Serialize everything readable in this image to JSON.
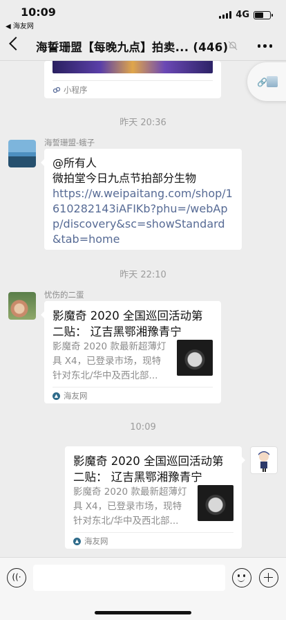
{
  "status_bar": {
    "time": "10:09",
    "back_app": "◀ 海友网",
    "network": "4G"
  },
  "nav": {
    "title": "海誓珊盟【每晚九点】拍卖... (446)"
  },
  "mini_program": {
    "label": "小程序"
  },
  "timestamps": [
    "昨天 20:36",
    "昨天 22:10",
    "10:09"
  ],
  "messages": [
    {
      "sender": "海誓珊盟-蛾子",
      "lines": [
        "@所有人",
        "微拍堂今日九点节拍部分生物"
      ],
      "link": "https://w.weipaitang.com/shop/1610282143iAFIKb?phu=/webApp/discovery&sc=showStandard&tab=home"
    },
    {
      "sender": "忧伤的二蛋",
      "card": {
        "title": "影魔奇 2020 全国巡回活动第二贴： 辽吉黑鄂湘豫青宁",
        "body": "影魔奇 2020 款最新超薄灯具 X4，已登录市场，现特针对东北/华中及西北部...",
        "source": "海友网"
      }
    },
    {
      "sender": "",
      "card": {
        "title": "影魔奇 2020 全国巡回活动第二贴： 辽吉黑鄂湘豫青宁",
        "body": "影魔奇 2020 款最新超薄灯具 X4，已登录市场，现特针对东北/华中及西北部...",
        "source": "海友网"
      }
    }
  ],
  "colors": {
    "link": "#576b95",
    "background": "#ededed"
  }
}
